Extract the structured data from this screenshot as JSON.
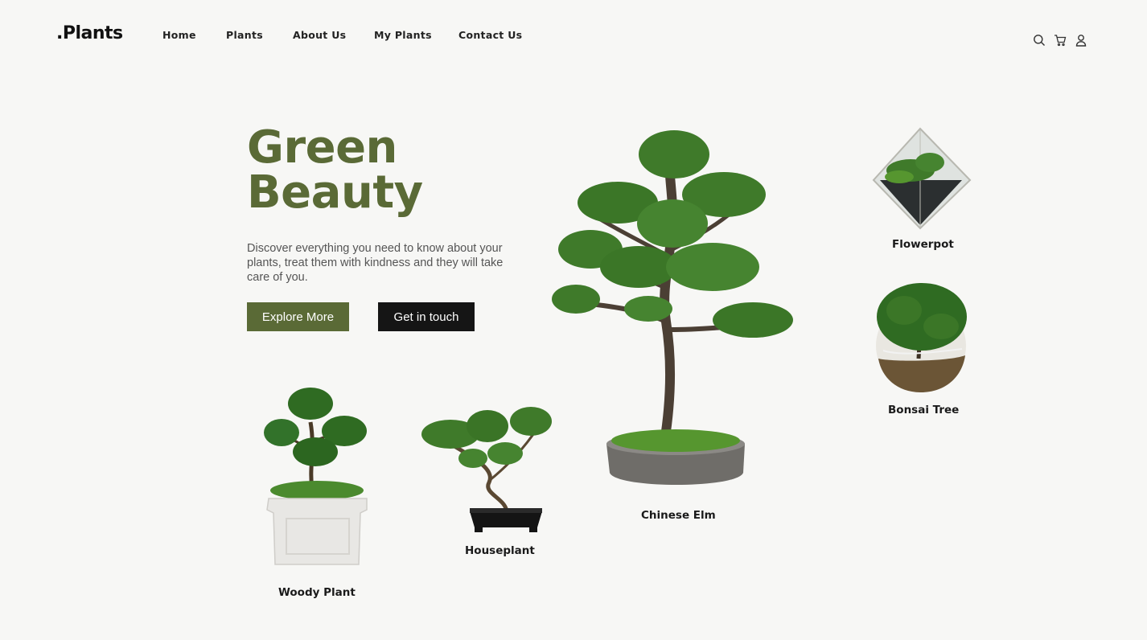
{
  "brand": {
    "logo": ".Plants"
  },
  "nav": {
    "items": [
      {
        "label": "Home"
      },
      {
        "label": "Plants"
      },
      {
        "label": "About Us"
      },
      {
        "label": "My Plants"
      },
      {
        "label": "Contact Us"
      }
    ]
  },
  "header_icons": [
    "search-icon",
    "cart-icon",
    "user-icon"
  ],
  "hero": {
    "title_line1": "Green",
    "title_line2": "Beauty",
    "description": "Discover everything you need to know about your plants, treat them with kindness and they will take care of you.",
    "primary_button": "Explore More",
    "secondary_button": "Get in touch"
  },
  "plants": [
    {
      "name": "Woody Plant"
    },
    {
      "name": "Houseplant"
    },
    {
      "name": "Chinese Elm"
    },
    {
      "name": "Flowerpot"
    },
    {
      "name": "Bonsai Tree"
    }
  ],
  "colors": {
    "background": "#f7f7f5",
    "accent": "#5a6a36",
    "dark_button": "#151515",
    "foliage": "#3f7a2a"
  }
}
